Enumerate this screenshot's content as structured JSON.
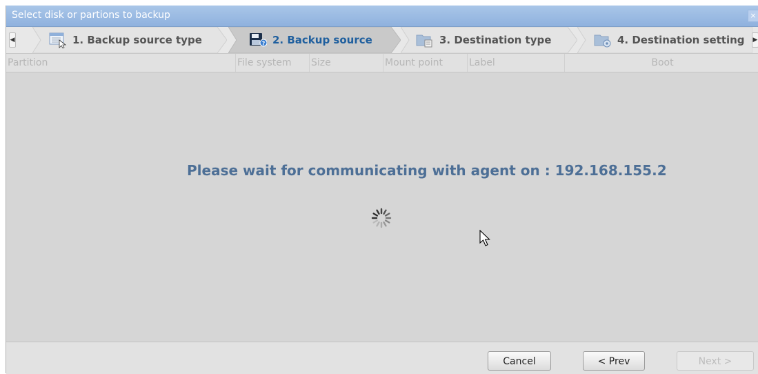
{
  "dialog": {
    "title": "Select disk or partions to backup",
    "close_glyph": "×"
  },
  "steps": {
    "prev_glyph": "◀",
    "next_glyph": "▶",
    "items": [
      {
        "label": "1. Backup source type",
        "icon": "list-window-icon",
        "state": "done"
      },
      {
        "label": "2. Backup source",
        "icon": "floppy-disk-icon",
        "state": "active"
      },
      {
        "label": "3. Destination type",
        "icon": "folder-icon",
        "state": "pending"
      },
      {
        "label": "4. Destination setting",
        "icon": "folder-gear-icon",
        "state": "pending"
      }
    ]
  },
  "table": {
    "columns": [
      "Partition",
      "File system",
      "Size",
      "Mount point",
      "Label",
      "Boot"
    ]
  },
  "status": {
    "message": "Please wait for communicating with agent on : 192.168.155.2"
  },
  "footer": {
    "cancel_label": "Cancel",
    "prev_label": "< Prev",
    "next_label": "Next >"
  },
  "colors": {
    "accent": "#1f5f9e",
    "title_bar": "#9bbce4",
    "message": "#4d6f96"
  }
}
